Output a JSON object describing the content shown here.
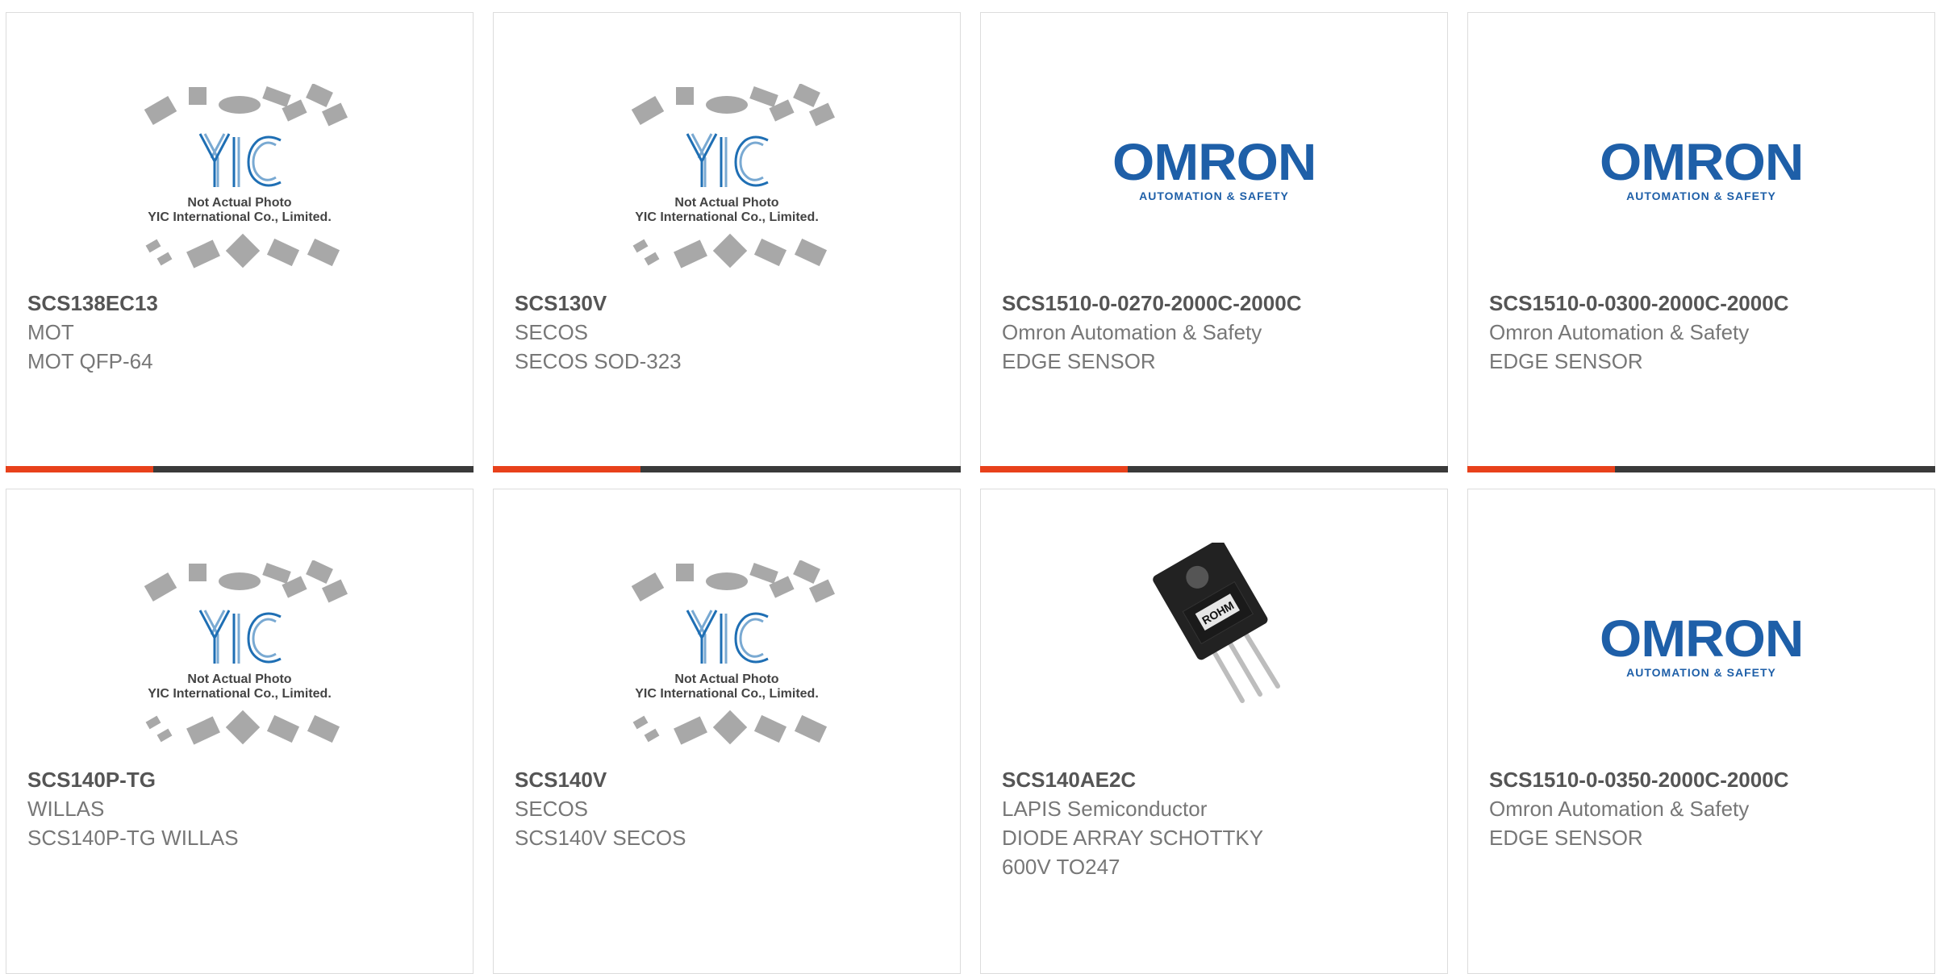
{
  "products": [
    {
      "part": "SCS138EC13",
      "maker": "MOT",
      "desc": [
        "MOT QFP-64"
      ],
      "image": "yic-placeholder",
      "placeholder_text": [
        "Not Actual Photo",
        "YIC International Co., Limited."
      ],
      "logo": "YIC"
    },
    {
      "part": "SCS130V",
      "maker": "SECOS",
      "desc": [
        "SECOS SOD-323"
      ],
      "image": "yic-placeholder",
      "placeholder_text": [
        "Not Actual Photo",
        "YIC International Co., Limited."
      ],
      "logo": "YIC"
    },
    {
      "part": "SCS1510-0-0270-2000C-2000C",
      "maker": "Omron Automation & Safety",
      "desc": [
        "EDGE SENSOR"
      ],
      "image": "omron-logo",
      "logo_text": [
        "OMRON",
        "AUTOMATION & SAFETY"
      ]
    },
    {
      "part": "SCS1510-0-0300-2000C-2000C",
      "maker": "Omron Automation & Safety",
      "desc": [
        "EDGE SENSOR"
      ],
      "image": "omron-logo",
      "logo_text": [
        "OMRON",
        "AUTOMATION & SAFETY"
      ]
    },
    {
      "part": "SCS140P-TG",
      "maker": "WILLAS",
      "desc": [
        "SCS140P-TG WILLAS"
      ],
      "image": "yic-placeholder",
      "placeholder_text": [
        "Not Actual Photo",
        "YIC International Co., Limited."
      ],
      "logo": "YIC"
    },
    {
      "part": "SCS140V",
      "maker": "SECOS",
      "desc": [
        "SCS140V SECOS"
      ],
      "image": "yic-placeholder",
      "placeholder_text": [
        "Not Actual Photo",
        "YIC International Co., Limited."
      ],
      "logo": "YIC"
    },
    {
      "part": "SCS140AE2C",
      "maker": "LAPIS Semiconductor",
      "desc": [
        "DIODE ARRAY SCHOTTKY",
        "600V TO247"
      ],
      "image": "to247-package-photo",
      "package_text": "ROHM"
    },
    {
      "part": "SCS1510-0-0350-2000C-2000C",
      "maker": "Omron Automation & Safety",
      "desc": [
        "EDGE SENSOR"
      ],
      "image": "omron-logo",
      "logo_text": [
        "OMRON",
        "AUTOMATION & SAFETY"
      ]
    }
  ],
  "colors": {
    "accent": "#e8411b",
    "bar": "#3a3a3a",
    "omron_blue": "#1e5fa8",
    "yic_blue": "#1f6fb4"
  }
}
